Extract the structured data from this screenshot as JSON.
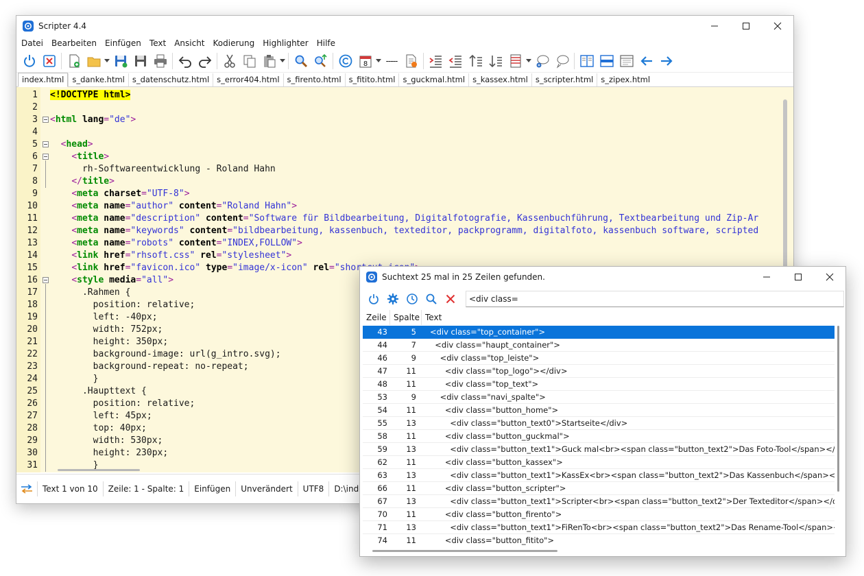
{
  "main_window": {
    "title": "Scripter 4.4",
    "menu": [
      "Datei",
      "Bearbeiten",
      "Einfügen",
      "Text",
      "Ansicht",
      "Kodierung",
      "Highlighter",
      "Hilfe"
    ],
    "toolbar": {
      "counter_value": "8",
      "dash_label": "-----"
    },
    "tabs": [
      "index.html",
      "s_danke.html",
      "s_datenschutz.html",
      "s_error404.html",
      "s_firento.html",
      "s_fitito.html",
      "s_guckmal.html",
      "s_kassex.html",
      "s_scripter.html",
      "s_zipex.html"
    ],
    "active_tab": "index.html",
    "line_numbers": [
      "1",
      "2",
      "3",
      "4",
      "5",
      "6",
      "7",
      "8",
      "9",
      "10",
      "11",
      "12",
      "13",
      "14",
      "15",
      "16",
      "17",
      "18",
      "19",
      "20",
      "21",
      "22",
      "23",
      "24",
      "25",
      "26",
      "27",
      "28",
      "29",
      "30",
      "31"
    ],
    "code_lines": [
      "<!DOCTYPE html>",
      "",
      "<html lang=\"de\">",
      "",
      "  <head>",
      "    <title>",
      "      rh-Softwareentwicklung - Roland Hahn",
      "    </title>",
      "    <meta charset=\"UTF-8\">",
      "    <meta name=\"author\" content=\"Roland Hahn\">",
      "    <meta name=\"description\" content=\"Software für Bildbearbeitung, Digitalfotografie, Kassenbuchführung, Textbearbeitung und Zip-Ar",
      "    <meta name=\"keywords\" content=\"bildbearbeitung, kassenbuch, texteditor, packprogramm, digitalfoto, kassenbuch software, scripted",
      "    <meta name=\"robots\" content=\"INDEX,FOLLOW\">",
      "    <link href=\"rhsoft.css\" rel=\"stylesheet\">",
      "    <link href=\"favicon.ico\" type=\"image/x-icon\" rel=\"shortcut icon\">",
      "    <style media=\"all\">",
      "      .Rahmen {",
      "        position: relative;",
      "        left: -40px;",
      "        width: 752px;",
      "        height: 350px;",
      "        background-image: url(g_intro.svg);",
      "        background-repeat: no-repeat;",
      "        }",
      "      .Haupttext {",
      "        position: relative;",
      "        left: 45px;",
      "        top: 40px;",
      "        width: 530px;",
      "        height: 230px;",
      "        }"
    ],
    "status": {
      "text_pos": "Text 1 von 10",
      "cursor": "Zeile: 1 - Spalte: 1",
      "mode": "Einfügen",
      "modified": "Unverändert",
      "encoding": "UTF8",
      "path": "D:\\index.html"
    }
  },
  "search_window": {
    "title": "Suchtext 25 mal in 25 Zeilen gefunden.",
    "query": "<div class=",
    "columns": {
      "zeile": "Zeile",
      "spalte": "Spalte",
      "text": "Text"
    },
    "results": [
      {
        "zeile": "43",
        "spalte": "5",
        "text": "<div class=\"top_container\">"
      },
      {
        "zeile": "44",
        "spalte": "7",
        "text": "  <div class=\"haupt_container\">"
      },
      {
        "zeile": "46",
        "spalte": "9",
        "text": "    <div class=\"top_leiste\">"
      },
      {
        "zeile": "47",
        "spalte": "11",
        "text": "      <div class=\"top_logo\"></div>"
      },
      {
        "zeile": "48",
        "spalte": "11",
        "text": "      <div class=\"top_text\">"
      },
      {
        "zeile": "53",
        "spalte": "9",
        "text": "    <div class=\"navi_spalte\">"
      },
      {
        "zeile": "54",
        "spalte": "11",
        "text": "      <div class=\"button_home\">"
      },
      {
        "zeile": "55",
        "spalte": "13",
        "text": "        <div class=\"button_text0\">Startseite</div>"
      },
      {
        "zeile": "58",
        "spalte": "11",
        "text": "      <div class=\"button_guckmal\">"
      },
      {
        "zeile": "59",
        "spalte": "13",
        "text": "        <div class=\"button_text1\">Guck mal<br><span class=\"button_text2\">Das Foto-Tool</span></div>"
      },
      {
        "zeile": "62",
        "spalte": "11",
        "text": "      <div class=\"button_kassex\">"
      },
      {
        "zeile": "63",
        "spalte": "13",
        "text": "        <div class=\"button_text1\">KassEx<br><span class=\"button_text2\">Das Kassenbuch</span></div>"
      },
      {
        "zeile": "66",
        "spalte": "11",
        "text": "      <div class=\"button_scripter\">"
      },
      {
        "zeile": "67",
        "spalte": "13",
        "text": "        <div class=\"button_text1\">Scripter<br><span class=\"button_text2\">Der Texteditor</span></div>"
      },
      {
        "zeile": "70",
        "spalte": "11",
        "text": "      <div class=\"button_firento\">"
      },
      {
        "zeile": "71",
        "spalte": "13",
        "text": "        <div class=\"button_text1\">FiRenTo<br><span class=\"button_text2\">Das Rename-Tool</span></div>"
      },
      {
        "zeile": "74",
        "spalte": "11",
        "text": "      <div class=\"button_fitito\">"
      }
    ],
    "selected_index": 0
  },
  "colors": {
    "accent": "#0a74da",
    "editor_bg": "#fdf8dc",
    "gutter_bg": "#faf3c8",
    "tag_bracket": "#9a1b9a",
    "tag_name": "#008a00",
    "attr_value": "#3333d6",
    "doctype_highlight": "#ffff00"
  },
  "icons": {
    "toolbar": [
      "power-icon",
      "close-file-icon",
      "new-file-icon",
      "open-folder-icon",
      "save-icon",
      "save-all-icon",
      "print-icon",
      "undo-icon",
      "redo-icon",
      "cut-icon",
      "copy-icon",
      "paste-icon",
      "find-icon",
      "replace-icon",
      "copyright-icon",
      "calendar-icon",
      "insert-file-icon",
      "indent-icon",
      "outdent-icon",
      "sort-asc-icon",
      "sort-desc-icon",
      "column-icon",
      "comment-add-icon",
      "comment-remove-icon",
      "split-vertical-icon",
      "split-horizontal-icon",
      "page-icon",
      "arrow-left-icon",
      "arrow-right-icon"
    ],
    "search_toolbar": [
      "power-icon",
      "gear-icon",
      "clock-icon",
      "search-icon",
      "close-icon"
    ]
  }
}
